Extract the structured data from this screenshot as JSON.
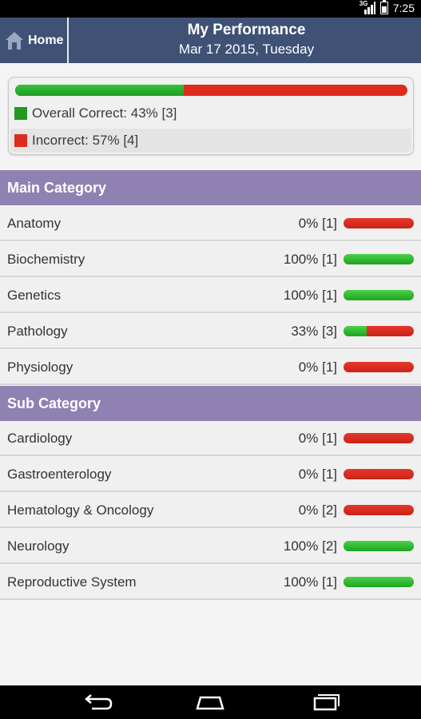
{
  "status_bar": {
    "network": "3G",
    "time": "7:25"
  },
  "header": {
    "home_label": "Home",
    "title": "My Performance",
    "date": "Mar 17 2015, Tuesday"
  },
  "summary": {
    "correct_fraction": 0.43,
    "correct_label": "Overall Correct: 43% [3]",
    "incorrect_label": "Incorrect: 57% [4]",
    "correct_color": "#1f9a22",
    "incorrect_color": "#dd2b1c"
  },
  "main_category": {
    "title": "Main Category",
    "items": [
      {
        "label": "Anatomy",
        "stat": "0% [1]",
        "fraction": 0
      },
      {
        "label": "Biochemistry",
        "stat": "100% [1]",
        "fraction": 1
      },
      {
        "label": "Genetics",
        "stat": "100% [1]",
        "fraction": 1
      },
      {
        "label": "Pathology",
        "stat": "33% [3]",
        "fraction": 0.33
      },
      {
        "label": "Physiology",
        "stat": "0% [1]",
        "fraction": 0
      }
    ]
  },
  "sub_category": {
    "title": "Sub Category",
    "items": [
      {
        "label": "Cardiology",
        "stat": "0% [1]",
        "fraction": 0
      },
      {
        "label": "Gastroenterology",
        "stat": "0% [1]",
        "fraction": 0
      },
      {
        "label": "Hematology & Oncology",
        "stat": "0% [2]",
        "fraction": 0
      },
      {
        "label": "Neurology",
        "stat": "100% [2]",
        "fraction": 1
      },
      {
        "label": "Reproductive System",
        "stat": "100% [1]",
        "fraction": 1
      }
    ]
  },
  "nav_icons": [
    "back-icon",
    "home-icon",
    "recent-apps-icon"
  ]
}
